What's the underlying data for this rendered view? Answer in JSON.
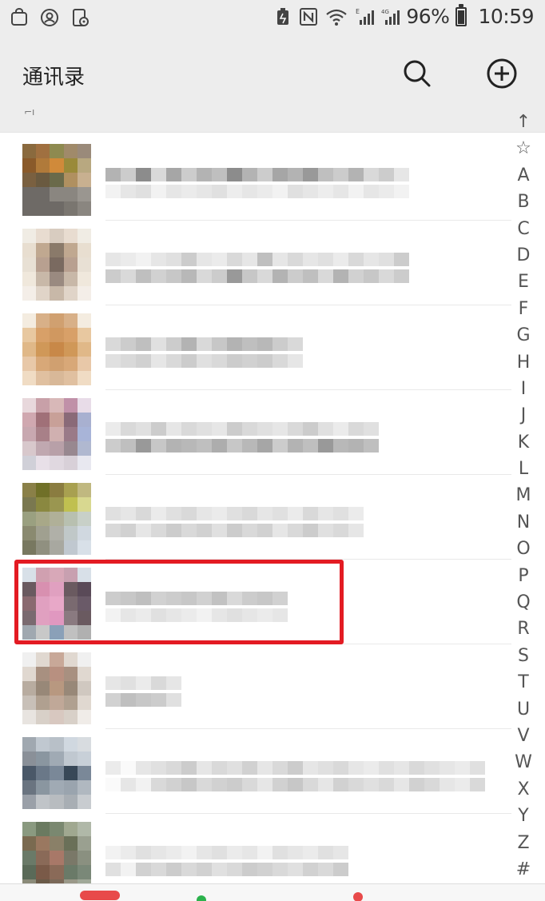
{
  "status_bar": {
    "battery": "96%",
    "time": "10:59",
    "left_icons": [
      "bag-icon",
      "user-circle-icon",
      "phone-settings-icon"
    ],
    "right_icons": [
      "battery-saver-icon",
      "nfc-icon",
      "wifi-icon",
      "signal-e-icon",
      "signal-4g-icon",
      "battery-icon"
    ]
  },
  "header": {
    "title": "通讯录",
    "sub_mark": "⌐ı",
    "search_icon": "search-icon",
    "add_icon": "add-circle-icon"
  },
  "contacts": [
    {
      "avatar_colors": [
        "#8a6a3e",
        "#a07040",
        "#8e8a50",
        "#a08a6a",
        "#9a8a7a",
        "#8a5a2a",
        "#b07a3a",
        "#d08a3a",
        "#9a8a3a",
        "#b8a880",
        "#7a6040",
        "#6a5a40",
        "#6a6a4a",
        "#b09060",
        "#c8b090",
        "#6e6a66",
        "#6e6a66",
        "#8a8680",
        "#8a8680",
        "#9a9690",
        "#6e6a66",
        "#6e6a66",
        "#6e6a66",
        "#7a7670",
        "#8a8680"
      ],
      "name_pattern": [
        [
          0.7,
          0.8,
          0.55,
          0.85,
          0.65,
          0.8,
          0.7,
          0.75,
          0.55,
          0.7,
          0.8,
          0.65,
          0.7,
          0.6,
          0.75,
          0.8,
          0.7,
          0.85,
          0.8,
          0.9
        ],
        [
          0.95,
          0.9,
          0.88,
          0.95,
          0.9,
          0.92,
          0.9,
          0.88,
          0.93,
          0.9,
          0.92,
          0.95,
          0.88,
          0.9,
          0.93,
          0.9,
          0.95,
          0.9,
          0.92,
          0.95
        ]
      ]
    },
    {
      "avatar_colors": [
        "#f0ece4",
        "#e8dcd0",
        "#d8ccc0",
        "#e8dcd0",
        "#f0ece4",
        "#e8ded0",
        "#c0a890",
        "#8a7a6a",
        "#c0a890",
        "#e8ded0",
        "#e8e0d4",
        "#b8a090",
        "#7a6a60",
        "#b8a090",
        "#e8e0d4",
        "#f0e8dc",
        "#c8b8a8",
        "#9a8a80",
        "#c8b8a8",
        "#f0e8dc",
        "#f4eee8",
        "#e0d4c8",
        "#c8b8a8",
        "#e0d4c8",
        "#f4eee8"
      ],
      "name_pattern": [
        [
          0.9,
          0.92,
          0.95,
          0.9,
          0.88,
          0.8,
          0.9,
          0.92,
          0.85,
          0.9,
          0.75,
          0.9,
          0.85,
          0.9,
          0.88,
          0.92,
          0.85,
          0.9,
          0.88,
          0.8
        ],
        [
          0.8,
          0.85,
          0.75,
          0.82,
          0.78,
          0.72,
          0.85,
          0.8,
          0.6,
          0.78,
          0.85,
          0.7,
          0.8,
          0.75,
          0.85,
          0.7,
          0.82,
          0.78,
          0.85,
          0.8
        ]
      ]
    },
    {
      "avatar_colors": [
        "#f4ece0",
        "#d8b088",
        "#d0a070",
        "#d8b088",
        "#f4ece0",
        "#e8c8a0",
        "#d8a068",
        "#d09860",
        "#d8a068",
        "#e8c8a0",
        "#e0b888",
        "#d09858",
        "#c88848",
        "#d09858",
        "#e0b888",
        "#e8c8a8",
        "#d8a878",
        "#d0a070",
        "#d8a878",
        "#e8c8a8",
        "#f0dcc4",
        "#e0c0a0",
        "#d8b898",
        "#e0c0a0",
        "#f0dcc4"
      ],
      "name_pattern": [
        [
          0.85,
          0.8,
          0.75,
          0.88,
          0.8,
          0.7,
          0.85,
          0.78,
          0.7,
          0.75,
          0.72,
          0.8,
          0.85
        ],
        [
          0.88,
          0.85,
          0.82,
          0.9,
          0.85,
          0.8,
          0.88,
          0.85,
          0.8,
          0.82,
          0.8,
          0.85,
          0.9
        ]
      ]
    },
    {
      "avatar_colors": [
        "#e8d8dc",
        "#c8a0a8",
        "#d8b8b8",
        "#c090a8",
        "#e8dce8",
        "#d0a8b0",
        "#a07078",
        "#c8a098",
        "#8a6a78",
        "#a8b0d0",
        "#c8a8b0",
        "#a88088",
        "#d0b0b0",
        "#9a7a88",
        "#a8b4d8",
        "#d8c8cc",
        "#c0a8b0",
        "#b8a0a8",
        "#988890",
        "#b0b8d0",
        "#d0d0d8",
        "#e8e0e8",
        "#e0d8e0",
        "#d8d0d8",
        "#e8e8f0"
      ],
      "name_pattern": [
        [
          0.92,
          0.85,
          0.88,
          0.8,
          0.9,
          0.85,
          0.88,
          0.9,
          0.8,
          0.85,
          0.88,
          0.9,
          0.85,
          0.8,
          0.88,
          0.92,
          0.85,
          0.88
        ],
        [
          0.8,
          0.75,
          0.6,
          0.78,
          0.7,
          0.72,
          0.75,
          0.68,
          0.78,
          0.72,
          0.65,
          0.8,
          0.7,
          0.75,
          0.6,
          0.72,
          0.7,
          0.75
        ]
      ]
    },
    {
      "avatar_colors": [
        "#8a8048",
        "#707028",
        "#8a7c40",
        "#a8a050",
        "#c0b880",
        "#7a7850",
        "#8a8840",
        "#9a9650",
        "#c0c050",
        "#d8d890",
        "#9aa080",
        "#a8a888",
        "#b0b098",
        "#b8c0b0",
        "#c8d0c8",
        "#8a8a70",
        "#a0a090",
        "#b0b0a8",
        "#c0c8c8",
        "#d0d8e0",
        "#787860",
        "#909080",
        "#a8a8a0",
        "#c0c8d0",
        "#d8e0e8"
      ],
      "name_pattern": [
        [
          0.88,
          0.9,
          0.85,
          0.92,
          0.88,
          0.85,
          0.9,
          0.92,
          0.88,
          0.85,
          0.9,
          0.88,
          0.92,
          0.85,
          0.9,
          0.88,
          0.92
        ],
        [
          0.85,
          0.82,
          0.9,
          0.85,
          0.8,
          0.85,
          0.82,
          0.88,
          0.8,
          0.85,
          0.82,
          0.9,
          0.85,
          0.8,
          0.88,
          0.85,
          0.9
        ]
      ]
    },
    {
      "avatar_colors": [
        "#d8e0e8",
        "#d0a0b0",
        "#d8a8b8",
        "#c8a0b0",
        "#d8e0e8",
        "#6a5a60",
        "#d890b0",
        "#e0a0c0",
        "#6a5a60",
        "#5a4a58",
        "#8a6a70",
        "#e0a0c0",
        "#e8a8c8",
        "#7a6a70",
        "#6a5a68",
        "#7a6a70",
        "#e0a0c0",
        "#e098c0",
        "#8a7a80",
        "#6a5a60",
        "#a0a8b0",
        "#c8c8c8",
        "#8aa0b8",
        "#c0c0c0",
        "#b0b0b0"
      ],
      "name_pattern": [
        [
          0.8,
          0.78,
          0.75,
          0.82,
          0.8,
          0.78,
          0.82,
          0.76,
          0.85,
          0.8,
          0.78,
          0.82
        ],
        [
          0.95,
          0.9,
          0.92,
          0.88,
          0.9,
          0.92,
          0.95,
          0.9,
          0.88,
          0.9,
          0.92,
          0.9
        ]
      ]
    },
    {
      "avatar_colors": [
        "#f0f0f0",
        "#e0d8d0",
        "#c8a898",
        "#e0d8d0",
        "#f0f0f0",
        "#e0d8d0",
        "#a89080",
        "#b89080",
        "#a89080",
        "#e0d8d0",
        "#b8aca0",
        "#988878",
        "#b89880",
        "#988878",
        "#d0c8c0",
        "#c8c0b8",
        "#b0a090",
        "#c0a898",
        "#b0a090",
        "#e0d8d0",
        "#e8e4e0",
        "#d8d0c8",
        "#d8c8c0",
        "#d8d0c8",
        "#f0ece8"
      ],
      "name_pattern": [
        [
          0.9,
          0.88,
          0.92,
          0.85,
          0.9
        ],
        [
          0.82,
          0.75,
          0.78,
          0.8,
          0.88
        ]
      ]
    },
    {
      "avatar_colors": [
        "#a0a8b0",
        "#c0c8d0",
        "#b8c0c8",
        "#d0d8e0",
        "#d8dce0",
        "#8a9098",
        "#8a96a0",
        "#a0aab4",
        "#c0c8d0",
        "#c8d0d8",
        "#4a5868",
        "#6a7888",
        "#7a8898",
        "#384858",
        "#7a8898",
        "#6a7480",
        "#8a96a0",
        "#a0aab4",
        "#9aa4ae",
        "#b0b8c0",
        "#9aa0a8",
        "#c0c4c8",
        "#b8bcc0",
        "#a8aeb4",
        "#c8ccd0"
      ],
      "name_pattern": [
        [
          0.92,
          0.98,
          0.9,
          0.88,
          0.85,
          0.8,
          0.9,
          0.85,
          0.88,
          0.82,
          0.9,
          0.85,
          0.8,
          0.9,
          0.88,
          0.85,
          0.9,
          0.92,
          0.88,
          0.9,
          0.85,
          0.88,
          0.9,
          0.92,
          0.88
        ],
        [
          0.98,
          0.9,
          0.95,
          0.85,
          0.82,
          0.78,
          0.85,
          0.82,
          0.8,
          0.85,
          0.9,
          0.82,
          0.78,
          0.85,
          0.9,
          0.82,
          0.85,
          0.88,
          0.85,
          0.9,
          0.82,
          0.85,
          0.9,
          0.92,
          0.85
        ]
      ]
    },
    {
      "avatar_colors": [
        "#8a9a80",
        "#6a7a60",
        "#7a8870",
        "#a0a890",
        "#b0b8a8",
        "#7a6a50",
        "#9a7860",
        "#8a8068",
        "#6a7058",
        "#9aa090",
        "#6a7a68",
        "#8a6a58",
        "#a87868",
        "#7a7868",
        "#8a9080",
        "#5a6a58",
        "#7a5a48",
        "#8a6a58",
        "#6a7a68",
        "#7a8878",
        "#8a8a78",
        "#6a5a48",
        "#7a6858",
        "#9a9888",
        "#a0a898"
      ],
      "name_pattern": [
        [
          0.95,
          0.92,
          0.88,
          0.9,
          0.92,
          0.95,
          0.9,
          0.88,
          0.92,
          0.9,
          0.95,
          0.88,
          0.9,
          0.92,
          0.88,
          0.9
        ],
        [
          0.88,
          0.95,
          0.82,
          0.85,
          0.8,
          0.85,
          0.82,
          0.88,
          0.85,
          0.8,
          0.82,
          0.85,
          0.88,
          0.82,
          0.85,
          0.8
        ]
      ]
    }
  ],
  "highlighted_contact_index": 5,
  "index_letters": [
    "↑",
    "☆",
    "A",
    "B",
    "C",
    "D",
    "E",
    "F",
    "G",
    "H",
    "I",
    "J",
    "K",
    "L",
    "M",
    "N",
    "O",
    "P",
    "Q",
    "R",
    "S",
    "T",
    "U",
    "V",
    "W",
    "X",
    "Y",
    "Z",
    "#"
  ],
  "colors": {
    "background": "#ededed",
    "list_bg": "#ffffff",
    "highlight": "#e31b23"
  }
}
